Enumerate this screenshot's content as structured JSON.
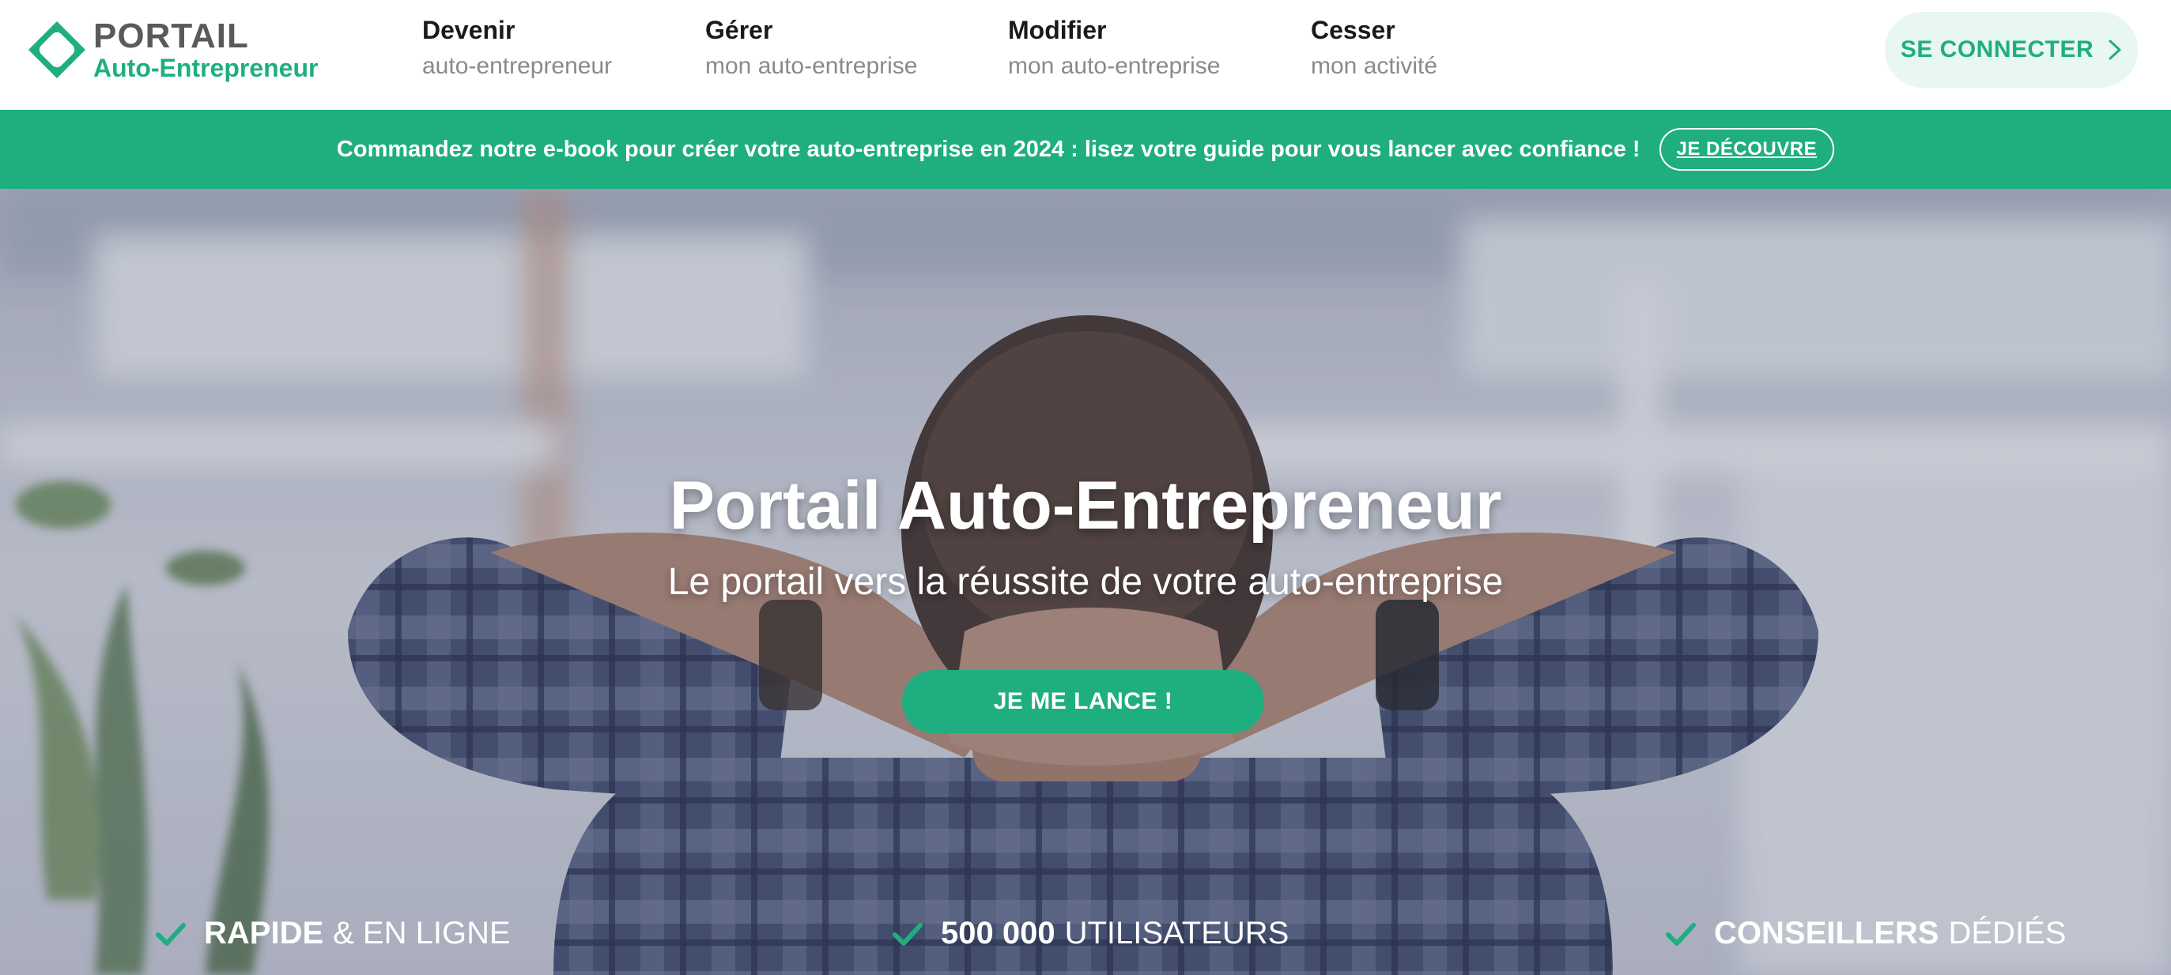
{
  "header": {
    "logo": {
      "line1": "PORTAIL",
      "line2": "Auto-Entrepreneur"
    },
    "nav": [
      {
        "title": "Devenir",
        "subtitle": "auto-entrepreneur"
      },
      {
        "title": "Gérer",
        "subtitle": "mon auto-entreprise"
      },
      {
        "title": "Modifier",
        "subtitle": "mon auto-entreprise"
      },
      {
        "title": "Cesser",
        "subtitle": "mon activité"
      }
    ],
    "connect_label": "SE CONNECTER"
  },
  "banner": {
    "text": "Commandez notre e-book pour créer votre auto-entreprise en 2024 : lisez votre guide pour vous lancer avec confiance !",
    "button_label": "JE DÉCOUVRE"
  },
  "hero": {
    "title": "Portail Auto-Entrepreneur",
    "subtitle": "Le portail vers la réussite de votre auto-entreprise",
    "cta_label": "JE ME LANCE !",
    "features": [
      {
        "strong": "RAPIDE",
        "light": "& EN LIGNE"
      },
      {
        "strong": "500 000",
        "light": "UTILISATEURS"
      },
      {
        "strong": "CONSEILLERS",
        "light": "DÉDIÉS"
      }
    ]
  },
  "colors": {
    "brand_green": "#1fae80",
    "nav_subtitle": "#8a8a8a",
    "connect_bg": "#e8f7f1"
  },
  "icons": [
    "logo-icon",
    "chevron-right-icon",
    "check-icon"
  ]
}
